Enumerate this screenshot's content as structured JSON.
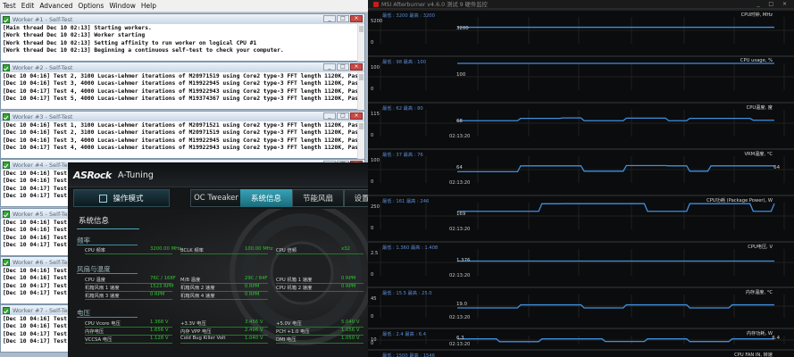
{
  "prime": {
    "menu": [
      "Test",
      "Edit",
      "Advanced",
      "Options",
      "Window",
      "Help"
    ],
    "windows": [
      {
        "title": "Worker #1 - Self-Test",
        "lines": [
          "[Main thread Dec 10 02:13] Starting workers.",
          "[Work thread Dec 10 02:13] Worker starting",
          "[Work thread Dec 10 02:13] Setting affinity to run worker on logical CPU #1",
          "[Work thread Dec 10 02:13] Beginning a continuous self-test to check your computer."
        ]
      },
      {
        "title": "Worker #2 - Self-Test",
        "lines": [
          "[Dec 10 04:16] Test 2, 3100 Lucas-Lehmer iterations of M20971519 using Core2 type-3 FFT length 1120K, Pass1=448, Pass2=2560.",
          "[Dec 10 04:16] Test 3, 4000 Lucas-Lehmer iterations of M19922945 using Core2 type-3 FFT length 1120K, Pass1=448, Pass2=2560.",
          "[Dec 10 04:17] Test 4, 4000 Lucas-Lehmer iterations of M19922943 using Core2 type-3 FFT length 1120K, Pass1=448, Pass2=2560.",
          "[Dec 10 04:17] Test 5, 4000 Lucas-Lehmer iterations of M19374367 using Core2 type-3 FFT length 1120K, Pass1=448, Pass2=2560."
        ]
      },
      {
        "title": "Worker #3 - Self-Test",
        "lines": [
          "[Dec 10 04:16] Test 1, 3100 Lucas-Lehmer iterations of M20971521 using Core2 type-3 FFT length 1120K, Pass1=448, Pass2=2560.",
          "[Dec 10 04:16] Test 2, 3100 Lucas-Lehmer iterations of M20971519 using Core2 type-3 FFT length 1120K, Pass1=448, Pass2=2560.",
          "[Dec 10 04:16] Test 3, 4000 Lucas-Lehmer iterations of M19922945 using Core2 type-3 FFT length 1120K, Pass1=448, Pass2=2560.",
          "[Dec 10 04:17] Test 4, 4000 Lucas-Lehmer iterations of M19922943 using Core2 type-3 FFT length 1120K, Pass1=448, Pass2=2560."
        ]
      },
      {
        "title": "Worker #4 - Self-Test",
        "lines": [
          "[Dec 10 04:16] Test 2, 31",
          "[Dec 10 04:16] Test 3, 40",
          "[Dec 10 04:17] Test 4, 40",
          "[Dec 10 04:17] Test 5, 40"
        ]
      },
      {
        "title": "Worker #5 - Self-Test",
        "lines": [
          "[Dec 10 04:16] Test 1, 31",
          "[Dec 10 04:16] Test 2, 31",
          "[Dec 10 04:16] Test 3, 40",
          "[Dec 10 04:17] Test 4, 40"
        ]
      },
      {
        "title": "Worker #6 - Self-Test",
        "lines": [
          "[Dec 10 04:16] Test 2, 31",
          "[Dec 10 04:16] Test 3, 40",
          "[Dec 10 04:17] Test 4, 40",
          "[Dec 10 04:17] Test 5, 40"
        ]
      },
      {
        "title": "Worker #7 - Self-Test",
        "lines": [
          "[Dec 10 04:16] Test 2, 31",
          "[Dec 10 04:16] Test 3, 40",
          "[Dec 10 04:17] Test 4, 40",
          "[Dec 10 04:17] Test 5, 40"
        ]
      }
    ]
  },
  "atuning": {
    "brand": "ASRock",
    "app": "A-Tuning",
    "tabs": [
      "操作模式",
      "OC Tweaker",
      "系统信息",
      "节能风扇",
      "设置"
    ],
    "section": "系统信息",
    "groups": [
      "频率",
      "风扇与温度",
      "电压"
    ],
    "freq": [
      {
        "label": "CPU 频率",
        "value": "3200.00 MHz"
      },
      {
        "label": "BCLK 频率",
        "value": "100.00 MHz"
      },
      {
        "label": "CPU 倍频",
        "value": "x32"
      }
    ],
    "temps": [
      {
        "label": "CPU 温度",
        "value": "76C / 168F"
      },
      {
        "label": "M/B 温度",
        "value": "29C / 84F"
      },
      {
        "label": "CPU 机箱 1 速度",
        "value": "0 RPM"
      },
      {
        "label": "机箱风扇 1 速度",
        "value": "1523 RPM"
      },
      {
        "label": "机箱风扇 2 速度",
        "value": "0 RPM"
      },
      {
        "label": "CPU 机箱 2 速度",
        "value": "0 RPM"
      },
      {
        "label": "机箱风扇 3 速度",
        "value": "0 RPM"
      },
      {
        "label": "机箱风扇 4 速度",
        "value": "0 RPM"
      }
    ],
    "volts": [
      {
        "label": "CPU Vcore 电压",
        "value": "1.368 V"
      },
      {
        "label": "+3.3V 电压",
        "value": "3.456 V"
      },
      {
        "label": "+5.0V 电压",
        "value": "5.040 V"
      },
      {
        "label": "内存电压",
        "value": "1.656 V"
      },
      {
        "label": "内存 VPP 电压",
        "value": "2.496 V"
      },
      {
        "label": "PCH +1.0 电压",
        "value": "1.056 V"
      },
      {
        "label": "VCCSA 电压",
        "value": "1.128 V"
      },
      {
        "label": "Cold Bug Killer Volt",
        "value": "1.040 V"
      },
      {
        "label": "DMI 电压",
        "value": "1.050 V"
      }
    ]
  },
  "afterburner": {
    "title": "MSI Afterburner v4.6.0 测试 9 硬件监控",
    "controls": "_ □ ×",
    "panels": [
      {
        "name": "CPU时钟, MHz",
        "stat": "最低 : 3200  最高 : 3200",
        "top": "5200",
        "bottom": "0",
        "val": "3200",
        "series": [
          3200,
          3200,
          3200,
          3200,
          3200,
          3200,
          3200,
          3200
        ]
      },
      {
        "name": "CPU usage, %",
        "stat": "最低 : 98  最高 : 100",
        "top": "100",
        "bottom": "0",
        "val": "100",
        "series": [
          100,
          100,
          100,
          100,
          100,
          100,
          100,
          100
        ]
      },
      {
        "name": "CPU温度, 度",
        "stat": "最低 : 62  最高 : 80",
        "top": "115",
        "bottom": "0",
        "val": "68",
        "series": [
          68,
          68,
          68,
          78,
          78,
          80,
          68,
          68,
          79,
          79,
          68,
          78,
          78,
          78,
          70,
          70
        ]
      },
      {
        "name": "VRM温度, °C",
        "stat": "最低 : 37  最高 : 76",
        "top": "100",
        "bottom": "0",
        "val": "64",
        "series": [
          42,
          42,
          42,
          64,
          64,
          64,
          44,
          44,
          65,
          65,
          64,
          44,
          64,
          64,
          64,
          64
        ]
      },
      {
        "name": "CPU功耗 (Package Power), W",
        "stat": "最低 : 161  最高 : 246",
        "top": "250",
        "bottom": "0",
        "val": "169",
        "series": [
          169,
          169,
          169,
          169,
          239,
          240,
          240,
          240,
          240,
          169,
          169,
          240,
          240,
          240,
          169,
          241
        ]
      },
      {
        "name": "CPU电压, V",
        "stat": "最低 : 1.360  最高 : 1.408",
        "top": "2.5",
        "bottom": "0",
        "val": "1.376",
        "series": [
          1.376,
          1.376,
          1.376,
          1.376,
          1.376,
          1.376,
          1.376,
          1.376
        ]
      },
      {
        "name": "内存温度, °C",
        "stat": "最低 : 15.5  最高 : 25.0",
        "top": "45",
        "bottom": "0",
        "val": "19.0",
        "series": [
          19,
          19,
          19,
          25,
          25,
          25,
          19,
          19,
          25,
          25,
          25,
          19,
          19,
          25,
          25,
          25
        ]
      },
      {
        "name": "内存功耗, W",
        "stat": "最低 : 2.4  最高 : 6.4",
        "top": "10",
        "bottom": "0",
        "val": "6.3",
        "series": [
          6.3,
          6.3,
          3.2,
          3.2,
          6.3,
          6.3,
          6.3,
          3.4,
          3.4,
          6.3,
          6.3,
          3.3,
          3.3,
          6.3,
          6.3,
          6.3
        ]
      },
      {
        "name": "CPU FAN IN, 转速",
        "stat": "最低 : 1500  最高 : 1546",
        "top": "10000",
        "bottom": "",
        "val": "",
        "series": []
      }
    ],
    "time_label": "02:13:20",
    "right_values": [
      "",
      "",
      "",
      "64",
      "",
      "",
      "",
      "6.4",
      ""
    ]
  }
}
